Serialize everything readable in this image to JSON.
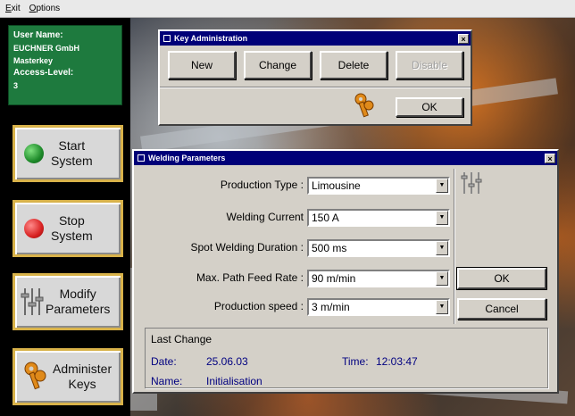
{
  "menu": {
    "items": [
      "Exit",
      "Options"
    ]
  },
  "user": {
    "name_label": "User Name:",
    "name_value": "EUCHNER GmbH Masterkey",
    "access_label": "Access-Level:",
    "access_value": "3"
  },
  "side_buttons": {
    "start": {
      "line1": "Start",
      "line2": "System",
      "icon": "green-led-icon"
    },
    "stop": {
      "line1": "Stop",
      "line2": "System",
      "icon": "red-led-icon"
    },
    "modify": {
      "line1": "Modify",
      "line2": "Parameters",
      "icon": "sliders-icon"
    },
    "keys": {
      "line1": "Administer",
      "line2": "Keys",
      "icon": "key-icon"
    }
  },
  "key_admin": {
    "title": "Key Administration",
    "buttons": {
      "new": "New",
      "change": "Change",
      "delete": "Delete",
      "disable": "Disable"
    },
    "ok": "OK"
  },
  "welding": {
    "title": "Welding Parameters",
    "fields": [
      {
        "label": "Production Type :",
        "value": "Limousine"
      },
      {
        "label": "Welding Current",
        "value": "150 A"
      },
      {
        "label": "Spot Welding Duration :",
        "value": "500 ms"
      },
      {
        "label": "Max. Path Feed Rate :",
        "value": "90 m/min"
      },
      {
        "label": "Production speed :",
        "value": "3 m/min"
      }
    ],
    "ok": "OK",
    "cancel": "Cancel",
    "last_change": {
      "heading": "Last Change",
      "date_label": "Date:",
      "date_value": "25.06.03",
      "time_label": "Time:",
      "time_value": "12:03:47",
      "name_label": "Name:",
      "name_value": "Initialisation"
    }
  },
  "colors": {
    "title_bar": "#000078",
    "user_panel": "#1e7a3e",
    "button_border": "#d8b24a"
  }
}
